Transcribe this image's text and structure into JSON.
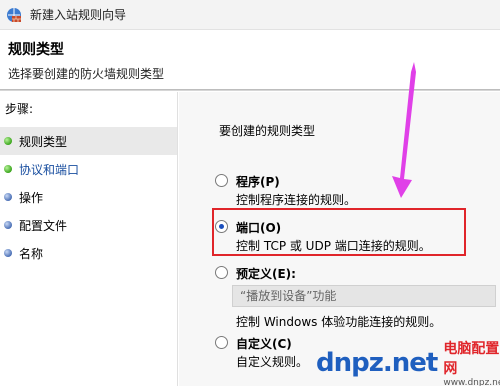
{
  "window": {
    "title": "新建入站规则向导"
  },
  "header": {
    "title": "规则类型",
    "subtitle": "选择要创建的防火墙规则类型"
  },
  "sidebar": {
    "label": "步骤:",
    "items": [
      {
        "label": "规则类型",
        "state": "current"
      },
      {
        "label": "协议和端口",
        "state": "active"
      },
      {
        "label": "操作",
        "state": "pending"
      },
      {
        "label": "配置文件",
        "state": "pending"
      },
      {
        "label": "名称",
        "state": "pending"
      }
    ]
  },
  "main": {
    "question": "要创建的规则类型",
    "options": [
      {
        "label": "程序(P)",
        "desc": "控制程序连接的规则。",
        "checked": false
      },
      {
        "label": "端口(O)",
        "desc": "控制 TCP 或 UDP 端口连接的规则。",
        "checked": true
      },
      {
        "label": "预定义(E):",
        "desc": "",
        "checked": false
      },
      {
        "label": "自定义(C)",
        "desc": "自定义规则。",
        "checked": false
      }
    ],
    "preset_value": "“播放到设备”功能",
    "preset_desc": "控制 Windows 体验功能连接的规则。"
  },
  "watermark": {
    "logo": "dnpz.net",
    "cn": "电脑配置网",
    "url": "www.dnpz.net"
  },
  "colors": {
    "highlight": "#e0252a",
    "arrow": "#e040e8",
    "radio_checked": "#1b4fbd",
    "step_done": "#3aa51c"
  }
}
